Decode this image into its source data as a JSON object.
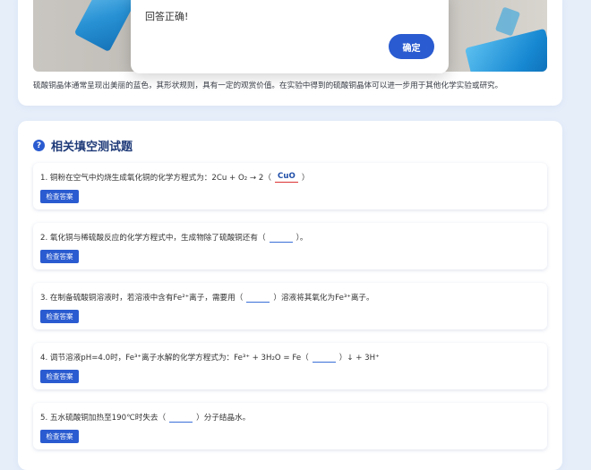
{
  "dialog": {
    "message": "回答正确!",
    "ok_label": "确定"
  },
  "intro": {
    "caption": "硫酸铜晶体通常呈现出美丽的蓝色，其形状规则，具有一定的观赏价值。在实验中得到的硫酸铜晶体可以进一步用于其他化学实验或研究。"
  },
  "section": {
    "title": "相关填空测试题",
    "icon_glyph": "?",
    "check_label": "检查答案",
    "questions": [
      {
        "before": "1. 铜粉在空气中灼烧生成氧化铜的化学方程式为：2Cu + O₂ → 2（",
        "answer": "CuO",
        "after": "）"
      },
      {
        "before": "2. 氧化铜与稀硫酸反应的化学方程式中，生成物除了硫酸铜还有（",
        "answer": "",
        "after": "）。"
      },
      {
        "before": "3. 在制备硫酸铜溶液时，若溶液中含有Fe²⁺离子，需要用（",
        "answer": "",
        "after": "）溶液将其氧化为Fe³⁺离子。"
      },
      {
        "before": "4. 调节溶液pH=4.0时，Fe³⁺离子水解的化学方程式为：Fe³⁺ + 3H₂O = Fe（",
        "answer": "",
        "after": "）↓ + 3H⁺"
      },
      {
        "before": "5. 五水硫酸铜加热至190℃时失去（",
        "answer": "",
        "after": "）分子结晶水。"
      }
    ]
  }
}
